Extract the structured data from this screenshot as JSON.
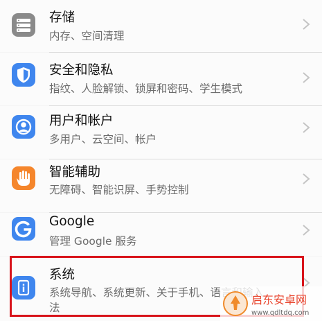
{
  "colors": {
    "storage_icon": "#8a8a8a",
    "security_icon": "#3f86ee",
    "users_icon": "#3f86ee",
    "accessibility_icon": "#f5862c",
    "google_icon": "#3f86ee",
    "system_icon": "#3f86ee",
    "highlight": "#d8141b"
  },
  "items": [
    {
      "title": "存储",
      "subtitle": "内存、空间清理",
      "icon": "storage-icon"
    },
    {
      "title": "安全和隐私",
      "subtitle": "指纹、人脸解锁、锁屏和密码、学生模式",
      "icon": "shield-icon"
    },
    {
      "title": "用户和帐户",
      "subtitle": "多用户、云空间、帐户",
      "icon": "user-icon"
    },
    {
      "title": "智能辅助",
      "subtitle": "无障碍、智能识屏、手势控制",
      "icon": "hand-icon"
    },
    {
      "title": "Google",
      "subtitle": "管理 Google 服务",
      "icon": "google-icon"
    },
    {
      "title": "系统",
      "subtitle": "系统导航、系统更新、关于手机、语言和输入",
      "subtitle_line2": "法",
      "icon": "info-icon"
    }
  ],
  "watermark": {
    "name": "启东安卓网",
    "url": "www.qdltdq.com"
  }
}
